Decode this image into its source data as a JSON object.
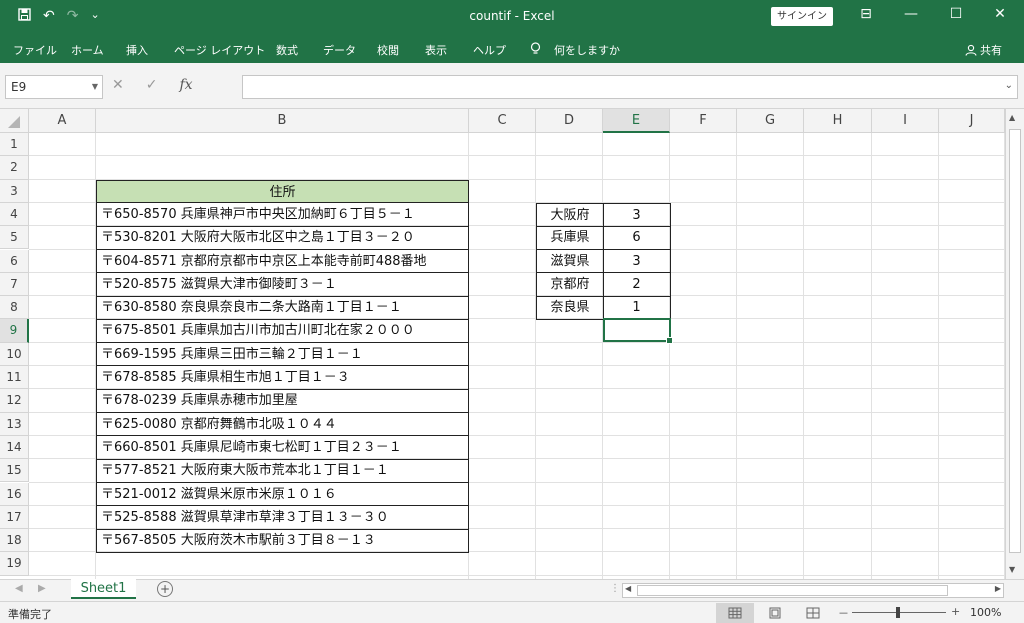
{
  "titlebar": {
    "title": "countif  -  Excel",
    "signin": "サインイン",
    "save_icon": "save-icon",
    "undo_glyph": "↶",
    "redo_glyph": "↷",
    "customize_glyph": "⌄",
    "ribbon_display_glyph": "⊟",
    "minimize_glyph": "—",
    "maximize_glyph": "☐",
    "close_glyph": "✕"
  },
  "ribbon": {
    "tabs": [
      "ファイル",
      "ホーム",
      "挿入",
      "ページ レイアウト",
      "数式",
      "データ",
      "校閲",
      "表示",
      "ヘルプ"
    ],
    "tellme": "何をしますか",
    "share": "共有"
  },
  "formulabar": {
    "namebox": "E9",
    "cancel_glyph": "✕",
    "enter_glyph": "✓",
    "fx_label": "fx",
    "formula": ""
  },
  "grid": {
    "columns": [
      "A",
      "B",
      "C",
      "D",
      "E",
      "F",
      "G",
      "H",
      "I",
      "J"
    ],
    "rows": [
      "1",
      "2",
      "3",
      "4",
      "5",
      "6",
      "7",
      "8",
      "9",
      "10",
      "11",
      "12",
      "13",
      "14",
      "15",
      "16",
      "17",
      "18",
      "19"
    ],
    "selected_column": "E",
    "selected_row": "9"
  },
  "table": {
    "header": "住所",
    "addresses": [
      "〒650-8570 兵庫県神戸市中央区加納町６丁目５－１",
      "〒530-8201 大阪府大阪市北区中之島１丁目３－２０",
      "〒604-8571 京都府京都市中京区上本能寺前町488番地",
      "〒520-8575 滋賀県大津市御陵町３－１",
      "〒630-8580 奈良県奈良市二条大路南１丁目１－１",
      "〒675-8501 兵庫県加古川市加古川町北在家２０００",
      "〒669-1595 兵庫県三田市三輪２丁目１－１",
      "〒678-8585 兵庫県相生市旭１丁目１－３",
      "〒678-0239 兵庫県赤穂市加里屋",
      "〒625-0080 京都府舞鶴市北吸１０４４",
      "〒660-8501 兵庫県尼崎市東七松町１丁目２３－１",
      "〒577-8521 大阪府東大阪市荒本北１丁目１－１",
      "〒521-0012 滋賀県米原市米原１０１６",
      "〒525-8588 滋賀県草津市草津３丁目１３－３０",
      "〒567-8505 大阪府茨木市駅前３丁目８－１３"
    ]
  },
  "counts": {
    "prefectures": [
      "大阪府",
      "兵庫県",
      "滋賀県",
      "京都府",
      "奈良県"
    ],
    "values": [
      "3",
      "6",
      "3",
      "2",
      "1"
    ]
  },
  "sheets": {
    "tabs": [
      "Sheet1"
    ],
    "add_glyph": "+"
  },
  "status": {
    "ready": "準備完了",
    "zoom": "100%",
    "zoom_minus": "－",
    "zoom_plus": "+"
  }
}
